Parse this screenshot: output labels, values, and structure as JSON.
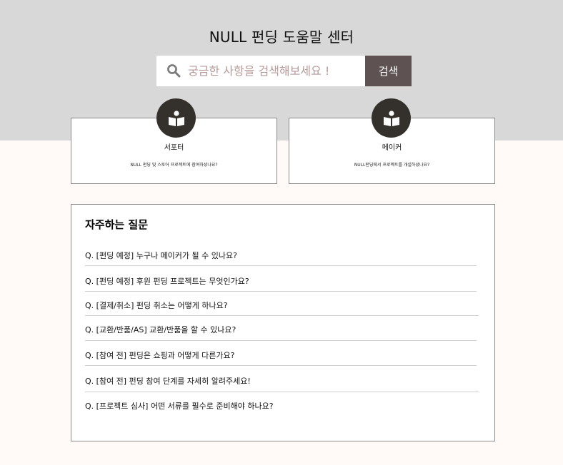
{
  "header": {
    "title": "NULL 펀딩 도움말 센터"
  },
  "search": {
    "placeholder": "궁금한 사항을 검색해보세요 !",
    "button_label": "검색",
    "icon": "search-icon"
  },
  "roles": [
    {
      "name": "서포터",
      "description": "NULL 펀딩 및 스토어 프로젝트에 참여하셨나요?",
      "icon": "book-reader-icon"
    },
    {
      "name": "메이커",
      "description": "NULL펀딩에서 프로젝트를 개설하셨나요?",
      "icon": "book-reader-icon"
    }
  ],
  "faq": {
    "title": "자주하는 질문",
    "items": [
      "Q. [펀딩 예정] 누구나 메이커가 될 수 있나요?",
      "Q. [펀딩 예정] 후원 펀딩 프로젝트는 무엇인가요?",
      "Q. [결제/취소] 펀딩 취소는 어떻게 하나요?",
      "Q. [교환/반품/AS] 교환/반품을 할 수 있나요?",
      "Q. [참여 전] 펀딩은 쇼핑과 어떻게 다른가요?",
      "Q. [참여 전] 펀딩 참여 단계를 자세히 알려주세요!",
      "Q. [프로젝트 심사] 어떤 서류를 필수로 준비해야 하나요?"
    ]
  },
  "colors": {
    "hero_bg": "#d8d8d8",
    "page_bg": "#fffaf8",
    "button_bg": "#5e5352",
    "badge_bg": "#34312c",
    "placeholder": "#b59a98"
  }
}
